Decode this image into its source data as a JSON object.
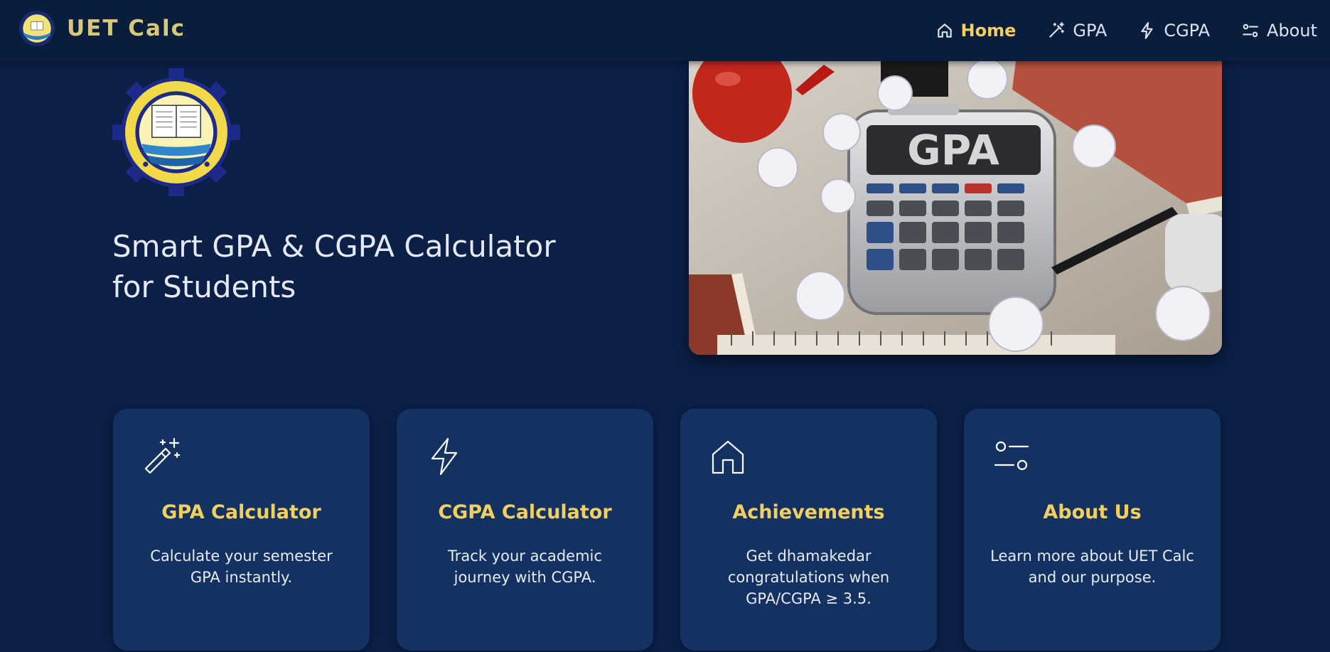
{
  "nav": {
    "brand": "UET Calc",
    "items": [
      {
        "label": "Home",
        "icon": "home-icon",
        "active": true
      },
      {
        "label": "GPA",
        "icon": "magic-wand-icon",
        "active": false
      },
      {
        "label": "CGPA",
        "icon": "lightning-icon",
        "active": false
      },
      {
        "label": "About",
        "icon": "sliders-icon",
        "active": false
      }
    ]
  },
  "hero": {
    "title_line1": "Smart GPA & CGPA Calculator",
    "title_line2": "for Students",
    "image_text": "GPA"
  },
  "cards": [
    {
      "title": "GPA Calculator",
      "desc": "Calculate your semester GPA instantly.",
      "icon": "magic-wand-icon"
    },
    {
      "title": "CGPA Calculator",
      "desc": "Track your academic journey with CGPA.",
      "icon": "lightning-icon"
    },
    {
      "title": "Achievements",
      "desc": "Get dhamakedar congratulations when GPA/CGPA ≥ 3.5.",
      "icon": "home-icon"
    },
    {
      "title": "About Us",
      "desc": "Learn more about UET Calc and our purpose.",
      "icon": "sliders-icon"
    }
  ],
  "colors": {
    "background": "#0c1f47",
    "navbar": "#0a1d3d",
    "card": "#133262",
    "accent": "#f3cf60",
    "brand": "#d9c77a"
  }
}
